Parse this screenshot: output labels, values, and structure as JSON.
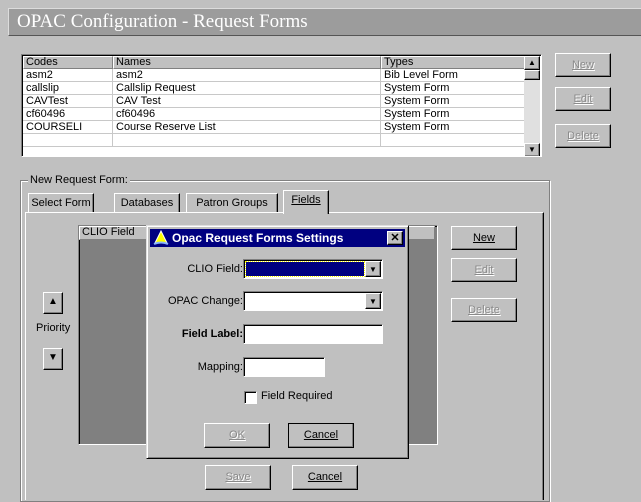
{
  "window": {
    "title": "OPAC Configuration - Request Forms"
  },
  "list": {
    "columns": [
      "Codes",
      "Names",
      "Types"
    ],
    "rows": [
      [
        "asm2",
        "asm2",
        "Bib Level Form"
      ],
      [
        "callslip",
        "Callslip Request",
        "System Form"
      ],
      [
        "CAVTest",
        "CAV Test",
        "System Form"
      ],
      [
        "cf60496",
        "cf60496",
        "System Form"
      ],
      [
        "COURSELI",
        "Course Reserve List",
        "System Form"
      ]
    ]
  },
  "side_buttons": {
    "new": "New",
    "edit": "Edit",
    "delete": "Delete"
  },
  "group": {
    "label": "New Request Form:"
  },
  "tabs": [
    "Select Form",
    "Databases",
    "Patron Groups",
    "Fields"
  ],
  "fields_tab": {
    "grid_header": "CLIO Field",
    "priority_label": "Priority",
    "new": "New",
    "edit": "Edit",
    "delete": "Delete",
    "save": "Save",
    "cancel": "Cancel"
  },
  "dialog": {
    "title": "Opac Request Forms Settings",
    "clio_field_label": "CLIO Field:",
    "opac_change_label": "OPAC Change:",
    "field_label_label": "Field Label:",
    "mapping_label": "Mapping:",
    "field_required_label": "Field Required",
    "ok": "OK",
    "cancel": "Cancel"
  },
  "colors": {
    "title_bar": "#000080",
    "selection": "#000080",
    "window_bg": "#c0c0c0"
  },
  "icons": [
    "close-icon",
    "dropdown-arrow-icon",
    "scroll-up-icon",
    "scroll-down-icon",
    "priority-up-icon",
    "priority-down-icon",
    "dialog-app-icon"
  ]
}
